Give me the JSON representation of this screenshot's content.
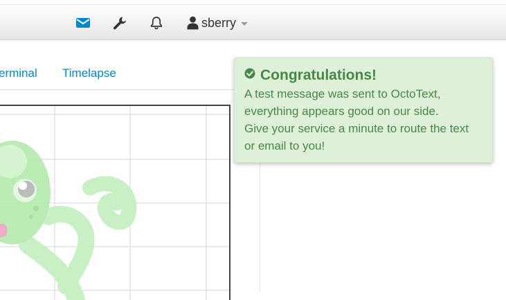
{
  "navbar": {
    "icons": [
      "envelope-icon",
      "wrench-icon",
      "bell-icon",
      "user-icon",
      "caret-down-icon"
    ],
    "username": "sberry"
  },
  "tabs": [
    {
      "label": "erminal"
    },
    {
      "label": "Timelapse"
    }
  ],
  "notification": {
    "title": "Congratulations!",
    "lines": [
      "A test message was sent to OctoText,",
      "everything appears good on our side.",
      "Give your service a minute to route the text",
      "or email to you!"
    ],
    "icon": "check-circle-icon"
  },
  "colors": {
    "link": "#0088cc",
    "envelope": "#0088cc",
    "alert_bg": "#dff0d8",
    "alert_text": "#468847",
    "octopus": "#aee8a7"
  }
}
